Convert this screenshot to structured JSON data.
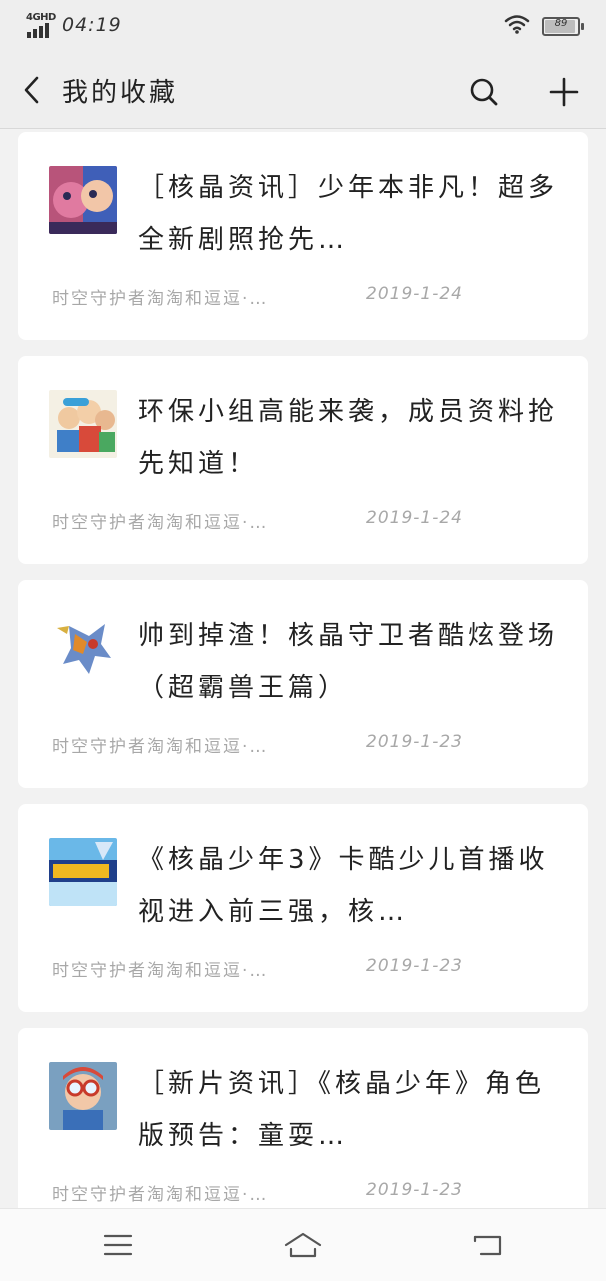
{
  "status_bar": {
    "network": "4GHD",
    "time": "04:19",
    "battery_text": "89",
    "battery_level": 0.89
  },
  "app_bar": {
    "title": "我的收藏",
    "icons": {
      "back": "back-arrow-icon",
      "search": "search-icon",
      "add": "plus-icon"
    }
  },
  "favorites": [
    {
      "title": "［核晶资讯］少年本非凡！超多全新剧照抢先…",
      "source": "时空守护者淘淘和逗逗·…",
      "date": "2019-1-24",
      "thumbnail": "cartoon-pink-characters-thumbnail"
    },
    {
      "title": "环保小组高能来袭，成员资料抢先知道！",
      "source": "时空守护者淘淘和逗逗·…",
      "date": "2019-1-24",
      "thumbnail": "cartoon-team-thumbnail"
    },
    {
      "title": "帅到掉渣！核晶守卫者酷炫登场（超霸兽王篇）",
      "source": "时空守护者淘淘和逗逗·…",
      "date": "2019-1-23",
      "thumbnail": "robot-beast-thumbnail"
    },
    {
      "title": "《核晶少年3》卡酷少儿首播收视进入前三强，核…",
      "source": "时空守护者淘淘和逗逗·…",
      "date": "2019-1-23",
      "thumbnail": "show-logo-thumbnail"
    },
    {
      "title": "［新片资讯］《核晶少年》角色版预告：童耍…",
      "source": "时空守护者淘淘和逗逗·…",
      "date": "2019-1-23",
      "thumbnail": "goggles-boy-thumbnail"
    }
  ],
  "nav_bar": {
    "icons": [
      "menu-icon",
      "home-icon",
      "back-icon"
    ]
  }
}
